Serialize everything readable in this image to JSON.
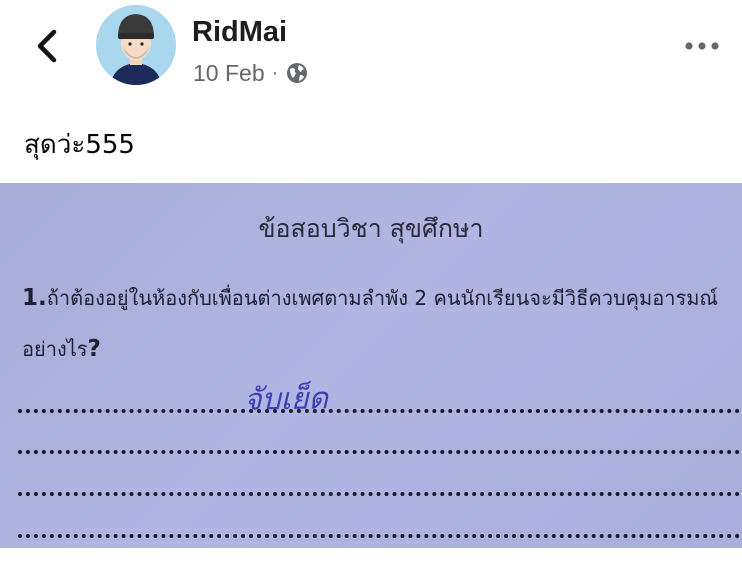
{
  "header": {
    "author_name": "RidMai",
    "date": "10 Feb",
    "separator": "·",
    "audience_icon": "globe-icon",
    "back_icon": "chevron-left-icon",
    "more_icon": "more-horizontal-icon"
  },
  "post": {
    "text": "สุดว่ะ555"
  },
  "photo": {
    "exam_title": "ข้อสอบวิชา สุขศึกษา",
    "question_number": "1.",
    "question_line1": "ถ้าต้องอยู่ในห้องกับเพื่อนต่างเพศตามลำพัง 2 คนนักเรียนจะมีวิธีควบคุมอารมณ์",
    "question_line2": "อย่างไร",
    "question_mark": "?",
    "handwritten_answer": "จับเย็ด"
  },
  "colors": {
    "name": "#1c1e21",
    "meta": "#65676b",
    "paper": "#aeb3e0",
    "ink": "#3b3fb3"
  }
}
